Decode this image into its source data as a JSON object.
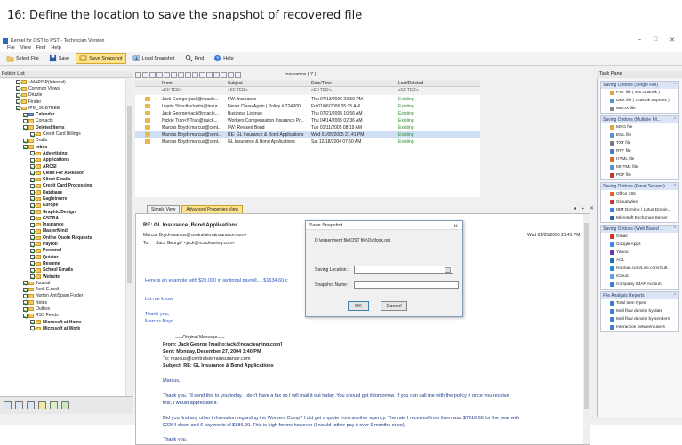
{
  "caption": "16: Define the location to save the snapshot of recovered file",
  "window": {
    "title": "Kernel for OST to PST - Technician Version",
    "controls": [
      "–",
      "□",
      "✕"
    ]
  },
  "menu": [
    "File",
    "View",
    "Find",
    "Help"
  ],
  "toolbar": {
    "select_file": "Select File",
    "save": "Save",
    "save_snapshot": "Save Snapshot",
    "load_snapshot": "Load Snapshot",
    "find": "Find",
    "help": "Help"
  },
  "folder_list": {
    "header": "Folder List",
    "items": [
      {
        "label": "~MAPISP(Internal)",
        "indent": 1,
        "checked": true,
        "bold": false
      },
      {
        "label": "Common Views",
        "indent": 1,
        "checked": true,
        "bold": false
      },
      {
        "label": "Drizzle",
        "indent": 1,
        "checked": true,
        "bold": false
      },
      {
        "label": "Finder",
        "indent": 1,
        "checked": true,
        "bold": false
      },
      {
        "label": "IPM_SUBTREE",
        "indent": 1,
        "checked": true,
        "bold": false
      },
      {
        "label": "Calendar",
        "indent": 2,
        "checked": true,
        "bold": true,
        "kind": "cal"
      },
      {
        "label": "Contacts",
        "indent": 2,
        "checked": true,
        "bold": false
      },
      {
        "label": "Deleted Items",
        "indent": 2,
        "checked": true,
        "bold": true
      },
      {
        "label": "Credit Card Billings",
        "indent": 3,
        "checked": true,
        "bold": false
      },
      {
        "label": "Drafts",
        "indent": 2,
        "checked": true,
        "bold": false
      },
      {
        "label": "Inbox",
        "indent": 2,
        "checked": true,
        "bold": true
      },
      {
        "label": "Advertising",
        "indent": 3,
        "checked": true,
        "bold": true
      },
      {
        "label": "Applications",
        "indent": 3,
        "checked": true,
        "bold": true
      },
      {
        "label": "ARCSI",
        "indent": 3,
        "checked": true,
        "bold": true
      },
      {
        "label": "Clean For A Reason",
        "indent": 3,
        "checked": true,
        "bold": true
      },
      {
        "label": "Client Emails",
        "indent": 3,
        "checked": true,
        "bold": true
      },
      {
        "label": "Credit Card Processing",
        "indent": 3,
        "checked": true,
        "bold": true
      },
      {
        "label": "Database",
        "indent": 3,
        "checked": true,
        "bold": true
      },
      {
        "label": "Eagletreerv",
        "indent": 3,
        "checked": true,
        "bold": true
      },
      {
        "label": "Europe",
        "indent": 3,
        "checked": true,
        "bold": true
      },
      {
        "label": "Graphic Design",
        "indent": 3,
        "checked": true,
        "bold": true
      },
      {
        "label": "GSDBA",
        "indent": 3,
        "checked": true,
        "bold": true
      },
      {
        "label": "Insurance",
        "indent": 3,
        "checked": true,
        "bold": true
      },
      {
        "label": "MasterMind",
        "indent": 3,
        "checked": true,
        "bold": true
      },
      {
        "label": "Online Quote Requests",
        "indent": 3,
        "checked": true,
        "bold": true
      },
      {
        "label": "Payroll",
        "indent": 3,
        "checked": true,
        "bold": true
      },
      {
        "label": "Personal",
        "indent": 3,
        "checked": true,
        "bold": true
      },
      {
        "label": "Quixtar",
        "indent": 3,
        "checked": true,
        "bold": true
      },
      {
        "label": "Resume",
        "indent": 3,
        "checked": true,
        "bold": true
      },
      {
        "label": "School Emails",
        "indent": 3,
        "checked": true,
        "bold": true
      },
      {
        "label": "Website",
        "indent": 3,
        "checked": true,
        "bold": true
      },
      {
        "label": "Journal",
        "indent": 2,
        "checked": true,
        "bold": false
      },
      {
        "label": "Junk E-mail",
        "indent": 2,
        "checked": true,
        "bold": false
      },
      {
        "label": "Norton AntiSpam Folder",
        "indent": 2,
        "checked": true,
        "bold": false
      },
      {
        "label": "Notes",
        "indent": 2,
        "checked": true,
        "bold": false
      },
      {
        "label": "Outbox",
        "indent": 2,
        "checked": true,
        "bold": false
      },
      {
        "label": "RSS Feeds",
        "indent": 2,
        "checked": true,
        "bold": false
      },
      {
        "label": "Microsoft at Home",
        "indent": 3,
        "checked": true,
        "bold": true
      },
      {
        "label": "Microsoft at Work",
        "indent": 3,
        "checked": true,
        "bold": true
      }
    ]
  },
  "grid": {
    "folder_label": "Insurance ( 7 )",
    "columns": [
      "From",
      "Subject",
      "Date/Time",
      "Lost/Deleted"
    ],
    "filter": "<FILTER>",
    "rows": [
      {
        "from": "Jack George<jack@ncacle...",
        "subject": "FW: Insurance",
        "date": "Thu 07/13/2006 23:50 PM",
        "status": "Existing",
        "selected": false
      },
      {
        "from": "Lupita Shoults<lupita@insur...",
        "subject": "Never Clean Again | Policy # 224P00...",
        "date": "Fri 01/06/2006 05:25 AM",
        "status": "Existing",
        "selected": false
      },
      {
        "from": "Jack George<jack@ncacle...",
        "subject": "Business License",
        "date": "Thu 07/21/2005 10:56 AM",
        "status": "Existing",
        "selected": false
      },
      {
        "from": "Nickie Tran<NTran@quick...",
        "subject": "Workers Compensation Insurance Pr...",
        "date": "Thu 04/14/2005 02:36 AM",
        "status": "Existing",
        "selected": false
      },
      {
        "from": "Marcus Boyd<marcus@cent...",
        "subject": "FW: Revised Bond",
        "date": "Tue 01/11/2005 08:19 AM",
        "status": "Existing",
        "selected": false
      },
      {
        "from": "Marcus Boyd<marcus@cent...",
        "subject": "RE: GL Insurance & Bond Applications",
        "date": "Wed 01/05/2005 21:41 PM",
        "status": "Existing",
        "selected": true
      },
      {
        "from": "Marcus Boyd<marcus@cent...",
        "subject": "GL Insurance & Bond Applications",
        "date": "Sat 12/18/2004 07:50 AM",
        "status": "Existing",
        "selected": false
      }
    ]
  },
  "view_tabs": [
    "Simple View",
    "Advanced Properties View"
  ],
  "preview": {
    "subject": "RE: GL Insurance ,Bond Applications",
    "from": "Marcus Boyd<marcus@centralsierrainsurance.com>",
    "to_label": "To:",
    "to": "'Jack George' <jack@ncacleaning.com>",
    "date": "Wed 01/05/2005 21:41 PM",
    "line1": "Here is an example with $20,000 in janitorial payroll....  $1634.60 c",
    "line2": "Let me know.",
    "line3": "Thank you,",
    "line4": "Marcus Boyd",
    "orig": "-----Original Message-----",
    "o_from": "From: Jack George [mailto:jack@ncacleaning.com]",
    "o_sent": "Sent: Monday, December 27, 2004 3:40 PM",
    "o_to": "To: marcus@centralsierrainsurance.com",
    "o_subj": "Subject: RE: GL Insurance & Bond Applications",
    "b1": "Marcus,",
    "b2": "Thank you.  I'll send this to you today.  I don't have a fax so I will mail it out today.  You should get it tomorrow.  If you can call me with the policy # once you receive",
    "b3": "this, I would appreciate it.",
    "b4": "Did you find any other information regarding the Workers Comp?  I did get a quote from another agency.  The rate I received from them was $7916.00 for the year with",
    "b5": "$2264 down and 6 payments of $886.00.  This is high for me however (I would rather pay it over 9 months or so).",
    "b6": "Thank you,"
  },
  "dialog": {
    "title": "Save Snapshot",
    "path": "D:\\experiment file\\OST file\\Outlook.ost",
    "saving_location_label": "Saving Location :",
    "saving_location_value": "",
    "snapshot_name_label": "Snapshot Name :",
    "snapshot_name_value": "",
    "ok": "OK",
    "cancel": "Cancel"
  },
  "task_pane": {
    "header": "Task Pane",
    "sections": [
      {
        "title": "Saving Options (Single File)",
        "items": [
          {
            "label": "PST file ( MS Outlook )",
            "color": "#e6a23c"
          },
          {
            "label": "DBX file ( Outlook Express )",
            "color": "#5b8fd6"
          },
          {
            "label": "MBOX file",
            "color": "#888888"
          }
        ]
      },
      {
        "title": "Saving Options (Multiple Fil...",
        "items": [
          {
            "label": "MSG file",
            "color": "#e6a23c"
          },
          {
            "label": "EML file",
            "color": "#5b8fd6"
          },
          {
            "label": "TXT file",
            "color": "#7a7a7a"
          },
          {
            "label": "RTF file",
            "color": "#4a7fc1"
          },
          {
            "label": "HTML file",
            "color": "#d66a2c"
          },
          {
            "label": "MHTML file",
            "color": "#5b8fd6"
          },
          {
            "label": "PDF file",
            "color": "#c0392b"
          }
        ]
      },
      {
        "title": "Saving Options (Email Servers)",
        "items": [
          {
            "label": "Office 365",
            "color": "#e35b25"
          },
          {
            "label": "GroupWise",
            "color": "#c0392b"
          },
          {
            "label": "IBM Domino ( Lotus Domin...",
            "color": "#3a7bd5"
          },
          {
            "label": "Microsoft Exchange Server",
            "color": "#2b5ea8"
          }
        ]
      },
      {
        "title": "Saving Options (Web Based ...",
        "items": [
          {
            "label": "Gmail",
            "color": "#d93025"
          },
          {
            "label": "Google Apps",
            "color": "#4285f4"
          },
          {
            "label": "Yahoo",
            "color": "#6d2fb0"
          },
          {
            "label": "AOL",
            "color": "#1f6fb4"
          },
          {
            "label": "Hotmail.com/Live.com/Outl...",
            "color": "#1e88e5"
          },
          {
            "label": "iCloud",
            "color": "#5aa0e6"
          },
          {
            "label": "Company IMAP Account",
            "color": "#3a7bd5"
          }
        ]
      },
      {
        "title": "File Analysis Reports",
        "items": [
          {
            "label": "Total item types",
            "color": "#3a7bd5"
          },
          {
            "label": "Mail flow density by date",
            "color": "#3a7bd5"
          },
          {
            "label": "Mail flow density by senders",
            "color": "#3a7bd5"
          },
          {
            "label": "Interaction between users",
            "color": "#3a7bd5"
          }
        ]
      }
    ]
  }
}
